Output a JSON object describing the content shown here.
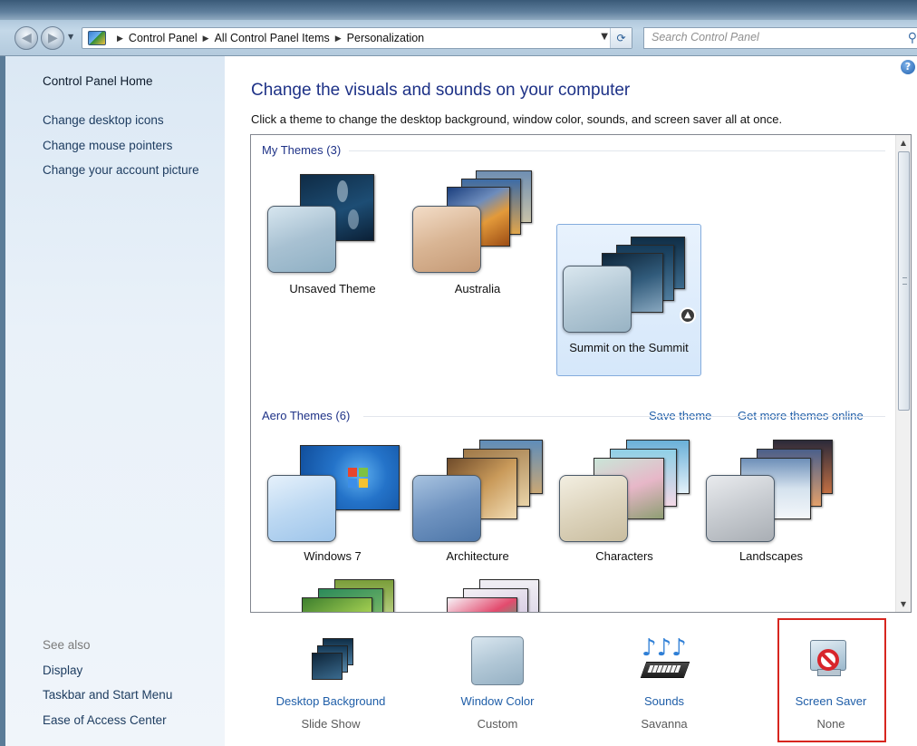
{
  "address_bar": {
    "crumbs": [
      "Control Panel",
      "All Control Panel Items",
      "Personalization"
    ]
  },
  "search": {
    "placeholder": "Search Control Panel"
  },
  "left_pane": {
    "home": "Control Panel Home",
    "links": [
      "Change desktop icons",
      "Change mouse pointers",
      "Change your account picture"
    ],
    "see_also_label": "See also",
    "see_also": [
      "Display",
      "Taskbar and Start Menu",
      "Ease of Access Center"
    ]
  },
  "main": {
    "title": "Change the visuals and sounds on your computer",
    "subtitle": "Click a theme to change the desktop background, window color, sounds, and screen saver all at once."
  },
  "my_themes": {
    "header": "My Themes (3)",
    "items": [
      {
        "label": "Unsaved Theme",
        "selected": false
      },
      {
        "label": "Australia",
        "selected": false
      },
      {
        "label": "Summit on the Summit",
        "selected": true
      }
    ],
    "save_link": "Save theme",
    "more_link": "Get more themes online"
  },
  "aero_themes": {
    "header": "Aero Themes (6)",
    "items": [
      {
        "label": "Windows 7"
      },
      {
        "label": "Architecture"
      },
      {
        "label": "Characters"
      },
      {
        "label": "Landscapes"
      },
      {
        "label": ""
      },
      {
        "label": ""
      }
    ]
  },
  "settings": [
    {
      "name": "Desktop Background",
      "value": "Slide Show",
      "icon": "desktop-background-icon"
    },
    {
      "name": "Window Color",
      "value": "Custom",
      "icon": "window-color-icon"
    },
    {
      "name": "Sounds",
      "value": "Savanna",
      "icon": "sounds-icon"
    },
    {
      "name": "Screen Saver",
      "value": "None",
      "icon": "screen-saver-icon"
    }
  ],
  "colors": {
    "title_blue": "#1e3287",
    "link_blue": "#1f5ea8",
    "highlight_red": "#d7261f",
    "selection_fill": "#dbeafb"
  }
}
